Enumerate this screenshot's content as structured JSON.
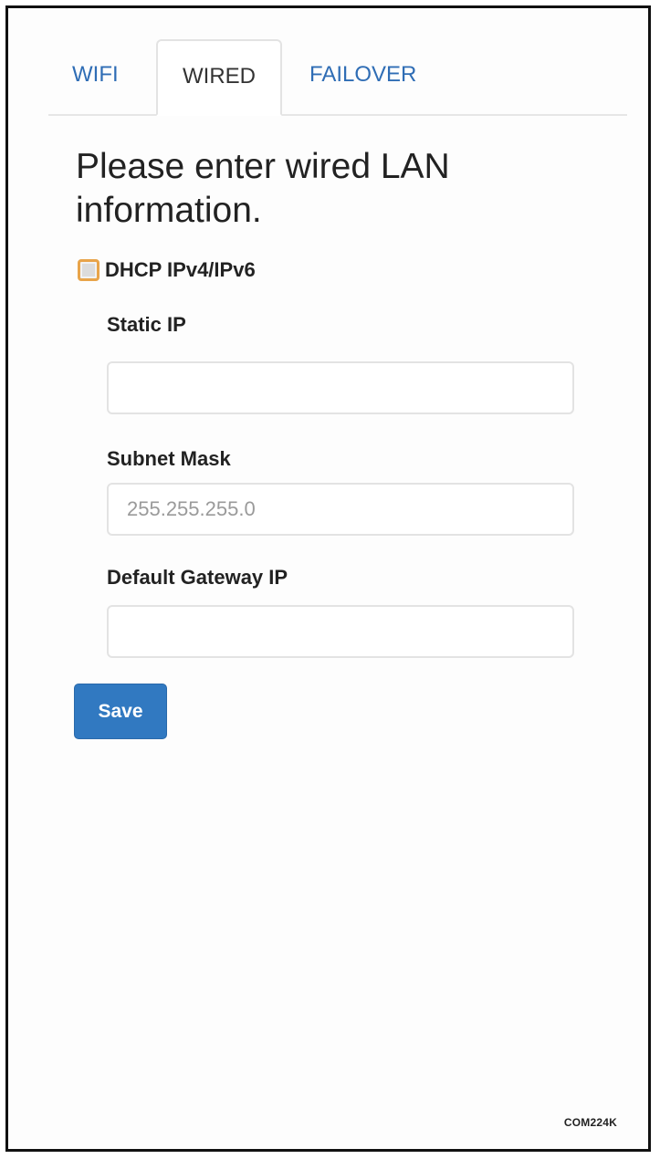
{
  "tabs": [
    {
      "label": "WIFI",
      "active": false
    },
    {
      "label": "WIRED",
      "active": true
    },
    {
      "label": "FAILOVER",
      "active": false
    }
  ],
  "heading": "Please enter wired LAN information.",
  "dhcp": {
    "label": "DHCP IPv4/IPv6",
    "checked": false
  },
  "fields": {
    "static_ip": {
      "label": "Static IP",
      "value": "",
      "placeholder": ""
    },
    "subnet_mask": {
      "label": "Subnet Mask",
      "value": "",
      "placeholder": "255.255.255.0"
    },
    "default_gateway": {
      "label": "Default Gateway IP",
      "value": "",
      "placeholder": ""
    }
  },
  "save_label": "Save",
  "figure_code": "COM224K",
  "colors": {
    "link": "#2f6db5",
    "primary_button": "#3179c1",
    "checkbox_focus": "#e8a44a"
  }
}
